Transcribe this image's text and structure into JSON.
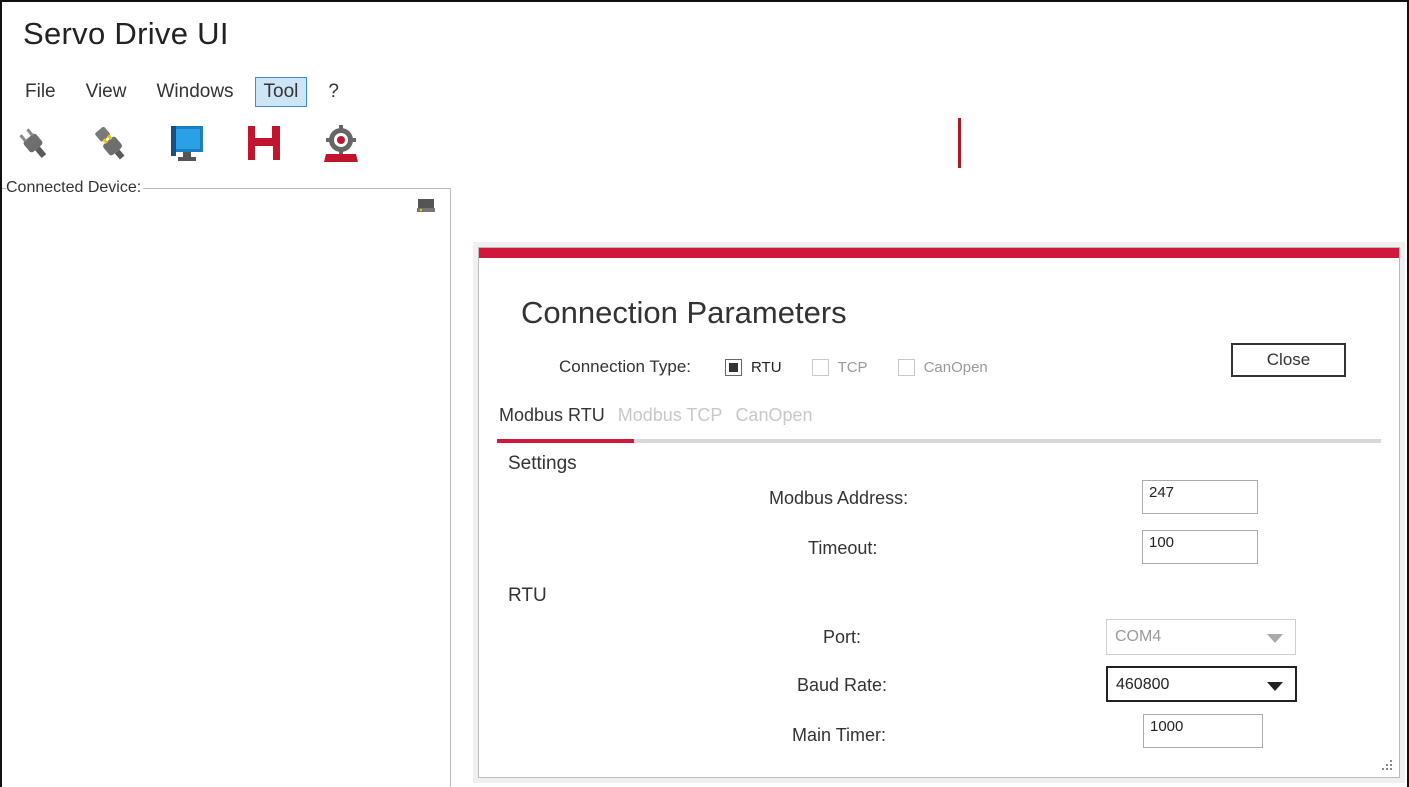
{
  "app": {
    "title": "Servo Drive UI"
  },
  "menu": {
    "items": [
      {
        "label": "File"
      },
      {
        "label": "View"
      },
      {
        "label": "Windows"
      },
      {
        "label": "Tool",
        "active": true
      },
      {
        "label": "?"
      }
    ]
  },
  "toolbar": {
    "buttons": [
      {
        "icon": "plug-disconnected-icon"
      },
      {
        "icon": "plug-connected-icon"
      },
      {
        "icon": "monitor-icon"
      },
      {
        "icon": "save-icon"
      },
      {
        "icon": "settings-gear-icon"
      }
    ]
  },
  "panel": {
    "connected_device_label": "Connected Device:"
  },
  "dialog": {
    "title": "Connection Parameters",
    "connection_type_label": "Connection Type:",
    "connection_types": [
      {
        "label": "RTU",
        "checked": true,
        "enabled": true
      },
      {
        "label": "TCP",
        "checked": false,
        "enabled": false
      },
      {
        "label": "CanOpen",
        "checked": false,
        "enabled": false
      }
    ],
    "close_label": "Close",
    "tabs": [
      {
        "label": "Modbus RTU",
        "active": true
      },
      {
        "label": "Modbus TCP",
        "active": false
      },
      {
        "label": "CanOpen",
        "active": false
      }
    ],
    "settings": {
      "section_title": "Settings",
      "modbus_address_label": "Modbus Address:",
      "modbus_address_value": "247",
      "timeout_label": "Timeout:",
      "timeout_value": "100"
    },
    "rtu": {
      "section_title": "RTU",
      "port_label": "Port:",
      "port_value": "COM4",
      "baud_rate_label": "Baud Rate:",
      "baud_rate_value": "460800",
      "main_timer_label": "Main Timer:",
      "main_timer_value": "1000"
    }
  },
  "colors": {
    "accent_red": "#d0173c",
    "dark_red_divider": "#b01b22",
    "menu_highlight_bg": "#cde6f7",
    "menu_highlight_border": "#3c8fd6"
  }
}
